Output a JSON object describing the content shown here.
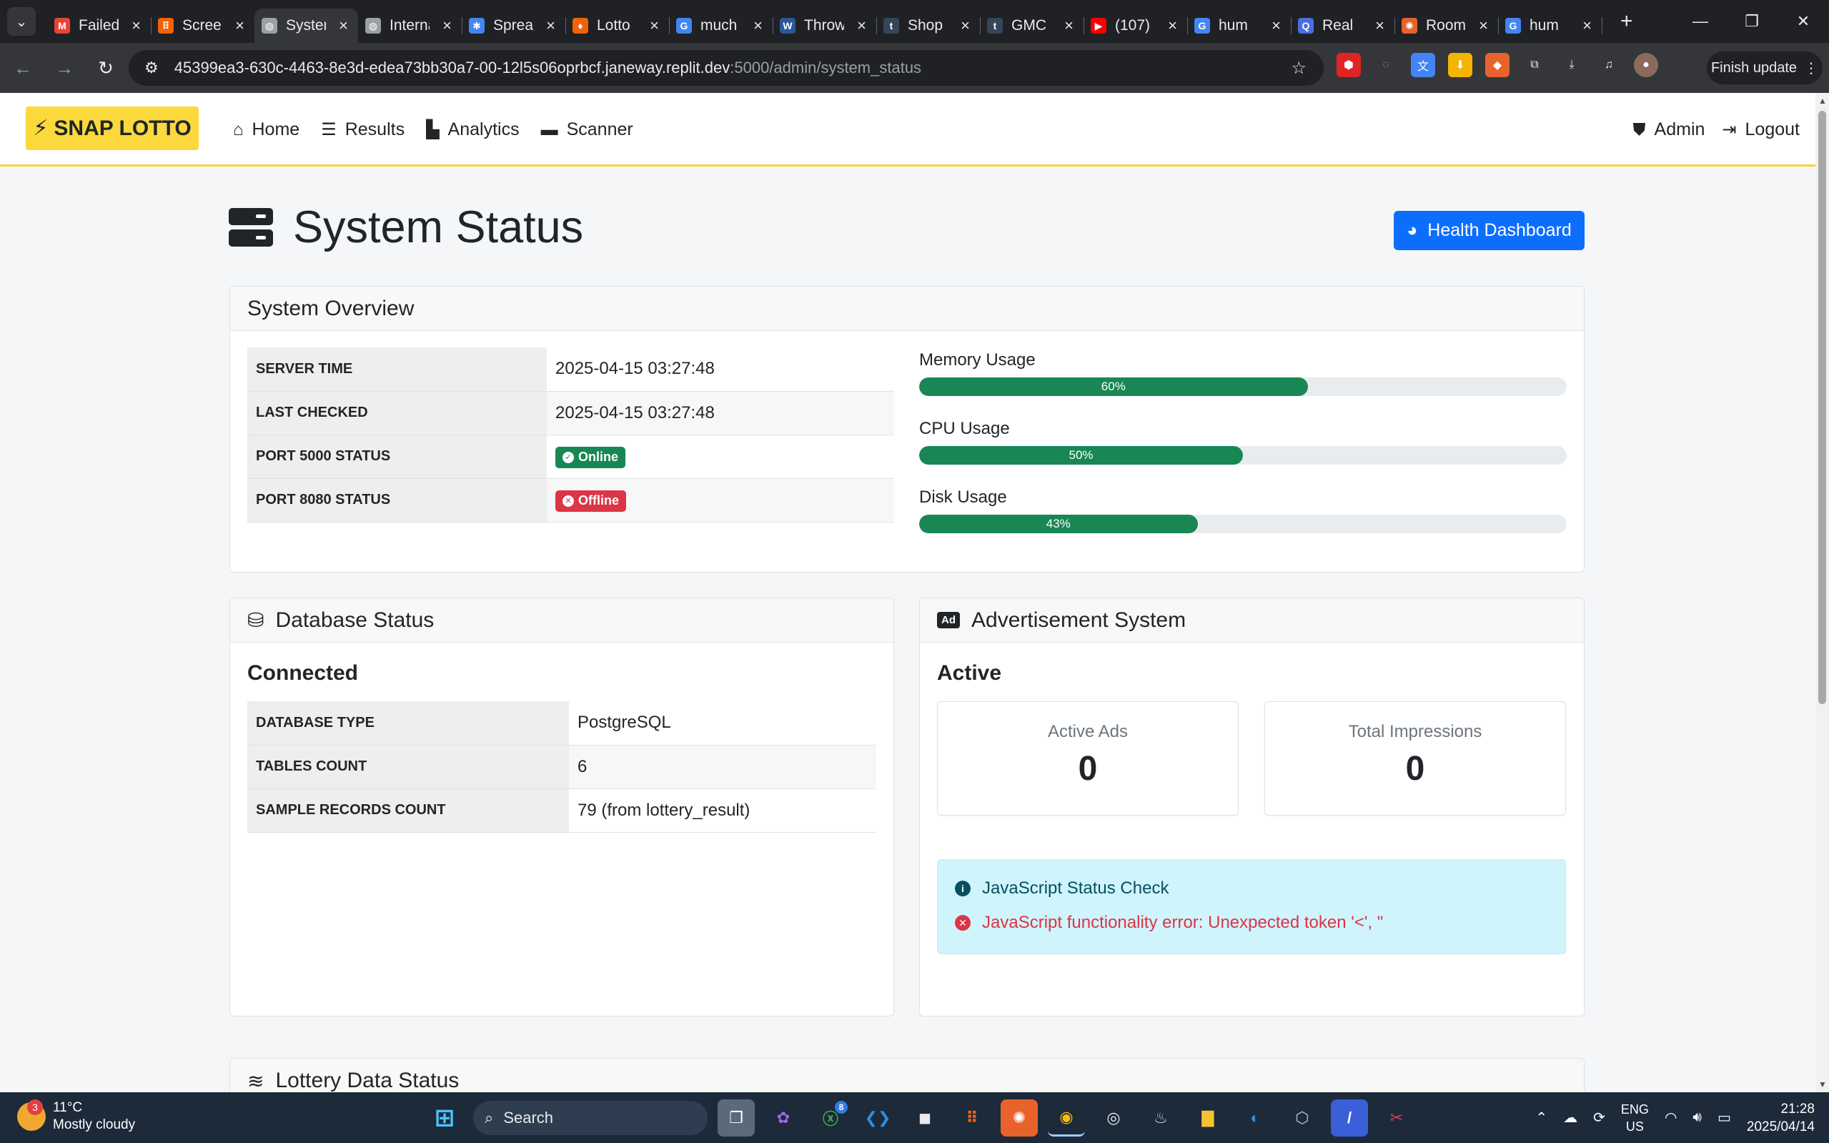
{
  "browser": {
    "tabs": [
      {
        "label": "Failed",
        "icon": "gmail-icon",
        "color": "#ea4335",
        "glyph": "M"
      },
      {
        "label": "Screen",
        "icon": "replit-icon",
        "color": "#f26207",
        "glyph": "⠿"
      },
      {
        "label": "System",
        "icon": "globe-icon",
        "color": "#9aa0a6",
        "glyph": "◍",
        "active": true
      },
      {
        "label": "Internal",
        "icon": "globe-icon",
        "color": "#9aa0a6",
        "glyph": "◍"
      },
      {
        "label": "Spreads",
        "icon": "spreads-icon",
        "color": "#4285f4",
        "glyph": "✱"
      },
      {
        "label": "Lotto",
        "icon": "flame-icon",
        "color": "#f26207",
        "glyph": "♦"
      },
      {
        "label": "much",
        "icon": "google-icon",
        "color": "#4285f4",
        "glyph": "G"
      },
      {
        "label": "Throw",
        "icon": "w-icon",
        "color": "#2b5797",
        "glyph": "W"
      },
      {
        "label": "Shop",
        "icon": "tumblr-icon",
        "color": "#35465c",
        "glyph": "t"
      },
      {
        "label": "GMC",
        "icon": "tumblr-icon",
        "color": "#35465c",
        "glyph": "t"
      },
      {
        "label": "(107)",
        "icon": "youtube-icon",
        "color": "#ff0000",
        "glyph": "▶"
      },
      {
        "label": "hum",
        "icon": "google-icon",
        "color": "#4285f4",
        "glyph": "G"
      },
      {
        "label": "Real",
        "icon": "quora-icon",
        "color": "#4a6ee0",
        "glyph": "Q"
      },
      {
        "label": "Room",
        "icon": "gear-orange-icon",
        "color": "#e8622c",
        "glyph": "✺"
      },
      {
        "label": "hum",
        "icon": "google-icon",
        "color": "#4285f4",
        "glyph": "G"
      }
    ],
    "url_main": "45399ea3-630c-4463-8e3d-edea73bb30a7-00-12l5s06oprbcf.janeway.replit.dev",
    "url_path": ":5000/admin/system_status",
    "finish_update": "Finish update"
  },
  "site": {
    "brand": "SNAP LOTTO",
    "nav": [
      {
        "label": "Home",
        "icon": "home-icon"
      },
      {
        "label": "Results",
        "icon": "list-icon"
      },
      {
        "label": "Analytics",
        "icon": "chart-icon"
      },
      {
        "label": "Scanner",
        "icon": "ticket-icon"
      }
    ],
    "admin": "Admin",
    "logout": "Logout"
  },
  "page": {
    "title": "System Status",
    "health_button": "Health Dashboard"
  },
  "overview": {
    "title": "System Overview",
    "rows": [
      {
        "key": "SERVER TIME",
        "value": "2025-04-15 03:27:48"
      },
      {
        "key": "LAST CHECKED",
        "value": "2025-04-15 03:27:48"
      },
      {
        "key": "PORT 5000 STATUS",
        "badge": "Online"
      },
      {
        "key": "PORT 8080 STATUS",
        "badge": "Offline"
      }
    ],
    "meters": [
      {
        "label": "Memory Usage",
        "percent": 60,
        "text": "60%"
      },
      {
        "label": "CPU Usage",
        "percent": 50,
        "text": "50%"
      },
      {
        "label": "Disk Usage",
        "percent": 43,
        "text": "43%"
      }
    ]
  },
  "database": {
    "title": "Database Status",
    "status": "Connected",
    "rows": [
      {
        "key": "DATABASE TYPE",
        "value": "PostgreSQL"
      },
      {
        "key": "TABLES COUNT",
        "value": "6"
      },
      {
        "key": "SAMPLE RECORDS COUNT",
        "value": "79 (from lottery_result)"
      }
    ]
  },
  "ads": {
    "title": "Advertisement System",
    "status": "Active",
    "active_ads_label": "Active Ads",
    "active_ads_value": "0",
    "impressions_label": "Total Impressions",
    "impressions_value": "0",
    "alert_title": "JavaScript Status Check",
    "alert_error": "JavaScript functionality error: Unexpected token '<', \""
  },
  "lottery": {
    "title": "Lottery Data Status"
  },
  "taskbar": {
    "temperature": "11°C",
    "weather": "Mostly cloudy",
    "weather_badge": "3",
    "search": "Search",
    "lang_top": "ENG",
    "lang_bottom": "US",
    "time": "21:28",
    "date": "2025/04/14",
    "xbox_badge": "8"
  },
  "colors": {
    "brand_yellow": "#fbd83c",
    "primary": "#0d6efd",
    "success": "#198754",
    "danger": "#dc3545",
    "info_bg": "#cff4fc"
  }
}
